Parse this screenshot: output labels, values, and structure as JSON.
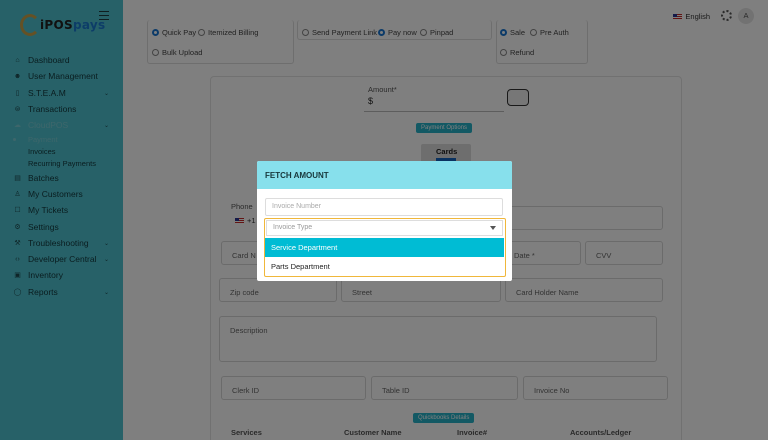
{
  "app": {
    "logo_text_1": "iPOS",
    "logo_text_2": "pays"
  },
  "topbar": {
    "language": "English",
    "avatar_initial": "A"
  },
  "sidebar": {
    "items": [
      {
        "label": "Dashboard",
        "icon": "home-icon"
      },
      {
        "label": "User Management",
        "icon": "users-icon"
      },
      {
        "label": "S.T.E.A.M",
        "icon": "device-icon",
        "has_chevron": true
      },
      {
        "label": "Transactions",
        "icon": "money-icon"
      },
      {
        "label": "CloudPOS",
        "icon": "cloud-icon",
        "has_chevron": true,
        "dim": true
      },
      {
        "label": "Payment",
        "sub": true,
        "dim": true
      },
      {
        "label": "Invoices",
        "sub": true
      },
      {
        "label": "Recurring Payments",
        "sub": true
      },
      {
        "label": "Batches",
        "icon": "batch-icon"
      },
      {
        "label": "My Customers",
        "icon": "customer-icon"
      },
      {
        "label": "My Tickets",
        "icon": "ticket-icon"
      },
      {
        "label": "Settings",
        "icon": "settings-icon"
      },
      {
        "label": "Troubleshooting",
        "icon": "tools-icon",
        "has_chevron": true
      },
      {
        "label": "Developer Central",
        "icon": "code-icon",
        "has_chevron": true
      },
      {
        "label": "Inventory",
        "icon": "box-icon"
      },
      {
        "label": "Reports",
        "icon": "chat-icon",
        "has_chevron": true
      }
    ]
  },
  "payment_options": {
    "group1": [
      "Quick Pay",
      "Itemized Billing",
      "Bulk Upload"
    ],
    "group2": [
      "Send Payment Link",
      "Pay now",
      "Pinpad"
    ],
    "group3": [
      "Sale",
      "Pre Auth",
      "Refund"
    ]
  },
  "form": {
    "amount_label": "Amount*",
    "amount_prefix": "$",
    "payment_options_badge": "Payment Options",
    "cards_label": "Cards",
    "phone_label": "Phone",
    "phone_code": "+1",
    "card_number_placeholder": "Card N",
    "expiry_placeholder": "Date *",
    "cvv_placeholder": "CVV",
    "zip_placeholder": "Zip code",
    "street_placeholder": "Street",
    "card_holder_placeholder": "Card Holder Name",
    "description_placeholder": "Description",
    "clerk_placeholder": "Clerk ID",
    "table_placeholder": "Table ID",
    "invoice_no_placeholder": "Invoice No",
    "quickbooks_badge": "Quickbooks Details",
    "col_services": "Services",
    "col_customer": "Customer Name",
    "col_invoice": "Invoice#",
    "col_accounts": "Accounts/Ledger"
  },
  "modal": {
    "title": "FETCH AMOUNT",
    "invoice_number_placeholder": "Invoice Number",
    "invoice_type_placeholder": "Invoice Type",
    "options": [
      "Service Department",
      "Parts Department"
    ],
    "highlighted": "Service Department"
  },
  "colors": {
    "sidebar": "#4fc3d0",
    "modal_header": "#87e0ec",
    "highlight": "#00bcd4",
    "focus": "#f0b73a"
  }
}
